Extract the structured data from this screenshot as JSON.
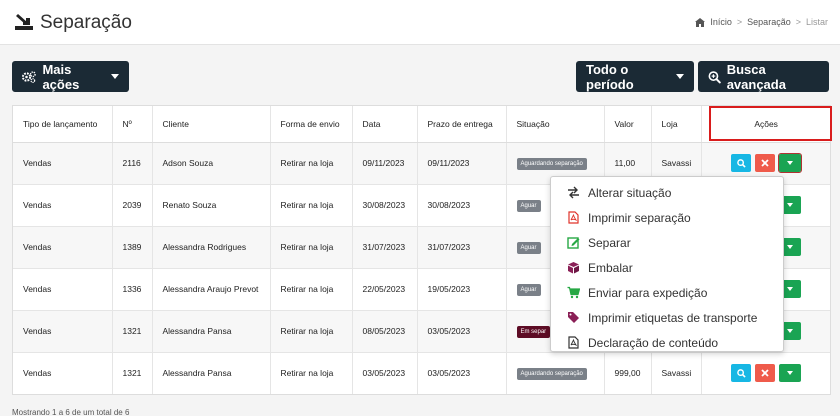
{
  "page": {
    "title": "Separação",
    "breadcrumb": [
      "Início",
      "Separação",
      "Listar"
    ]
  },
  "toolbar": {
    "more_actions": "Mais ações",
    "period": "Todo o período",
    "advanced_search": "Busca avançada"
  },
  "table": {
    "headers": [
      "Tipo de lançamento",
      "Nº",
      "Cliente",
      "Forma de envio",
      "Data",
      "Prazo de entrega",
      "Situação",
      "Valor",
      "Loja",
      "Ações"
    ],
    "rows": [
      {
        "tipo": "Vendas",
        "num": "2116",
        "cliente": "Adson Souza",
        "envio": "Retirar na loja",
        "data": "09/11/2023",
        "prazo": "09/11/2023",
        "situacao": "Aguardando separação",
        "valor": "11,00",
        "loja": "Savassi"
      },
      {
        "tipo": "Vendas",
        "num": "2039",
        "cliente": "Renato Souza",
        "envio": "Retirar na loja",
        "data": "30/08/2023",
        "prazo": "30/08/2023",
        "situacao": "Aguar",
        "valor": "",
        "loja": ""
      },
      {
        "tipo": "Vendas",
        "num": "1389",
        "cliente": "Alessandra Rodrigues",
        "envio": "Retirar na loja",
        "data": "31/07/2023",
        "prazo": "31/07/2023",
        "situacao": "Aguar",
        "valor": "",
        "loja": ""
      },
      {
        "tipo": "Vendas",
        "num": "1336",
        "cliente": "Alessandra Araujo Prevot",
        "envio": "Retirar na loja",
        "data": "22/05/2023",
        "prazo": "19/05/2023",
        "situacao": "Aguar",
        "valor": "",
        "loja": ""
      },
      {
        "tipo": "Vendas",
        "num": "1321",
        "cliente": "Alessandra Pansa",
        "envio": "Retirar na loja",
        "data": "08/05/2023",
        "prazo": "03/05/2023",
        "situacao": "Em separ",
        "valor": "",
        "loja": ""
      },
      {
        "tipo": "Vendas",
        "num": "1321",
        "cliente": "Alessandra Pansa",
        "envio": "Retirar na loja",
        "data": "03/05/2023",
        "prazo": "03/05/2023",
        "situacao": "Aguardando separação",
        "valor": "999,00",
        "loja": "Savassi"
      }
    ]
  },
  "dropdown": {
    "items": [
      {
        "label": "Alterar situação",
        "icon": "swap-icon"
      },
      {
        "label": "Imprimir separação",
        "icon": "pdf-icon"
      },
      {
        "label": "Separar",
        "icon": "edit-icon"
      },
      {
        "label": "Embalar",
        "icon": "box-icon"
      },
      {
        "label": "Enviar para expedição",
        "icon": "cart-icon"
      },
      {
        "label": "Imprimir etiquetas de transporte",
        "icon": "tag-icon"
      },
      {
        "label": "Declaração de conteúdo",
        "icon": "document-icon"
      }
    ]
  },
  "footer": {
    "summary": "Mostrando 1 a 6 de um total de 6"
  },
  "colors": {
    "dark_button": "#1b2a35",
    "action_blue": "#17b7e4",
    "action_red": "#ef5b4b",
    "action_green": "#1aa453",
    "badge_gray": "#7a8088",
    "badge_dark": "#5d0c25",
    "highlight": "#d91c1c"
  }
}
